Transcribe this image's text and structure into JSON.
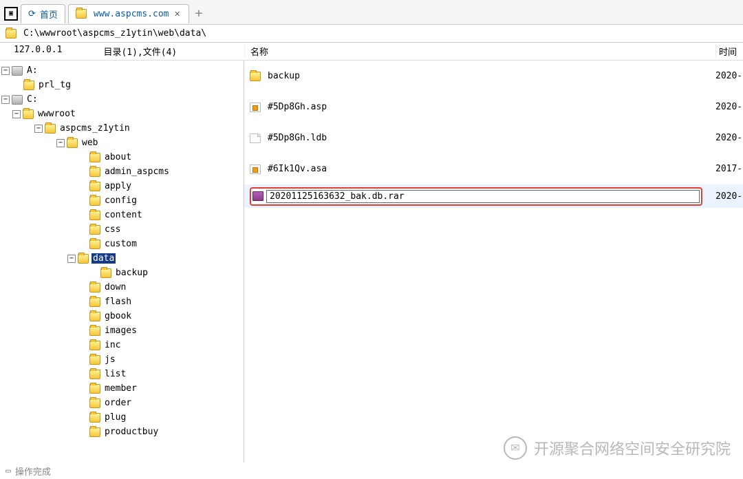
{
  "tabs": {
    "home_label": "首页",
    "active_label": "www.aspcms.com",
    "add_symbol": "+"
  },
  "path": "C:\\wwwroot\\aspcms_z1ytin\\web\\data\\",
  "header": {
    "ip": "127.0.0.1",
    "dir_count": "目录(1),文件(4)",
    "name_col": "名称",
    "time_col": "时间"
  },
  "tree": {
    "a_drive": "A:",
    "a_child": "prl_tg",
    "c_drive": "C:",
    "wwwroot": "wwwroot",
    "aspcms": "aspcms_z1ytin",
    "web": "web",
    "children": [
      "about",
      "admin_aspcms",
      "apply",
      "config",
      "content",
      "css",
      "custom"
    ],
    "data": "data",
    "backup": "backup",
    "children2": [
      "down",
      "flash",
      "gbook",
      "images",
      "inc",
      "js",
      "list",
      "member",
      "order",
      "plug",
      "productbuy"
    ]
  },
  "files": [
    {
      "name": "backup",
      "type": "folder",
      "time": "2020-"
    },
    {
      "name": "#5Dp8Gh.asp",
      "type": "asp",
      "time": "2020-"
    },
    {
      "name": "#5Dp8Gh.ldb",
      "type": "file",
      "time": "2020-"
    },
    {
      "name": "#6Ik1Qv.asa",
      "type": "asp",
      "time": "2017-"
    }
  ],
  "editing": {
    "value": "20201125163632_bak.db.rar",
    "time": "2020-"
  },
  "status": "操作完成",
  "watermark": "开源聚合网络空间安全研究院"
}
